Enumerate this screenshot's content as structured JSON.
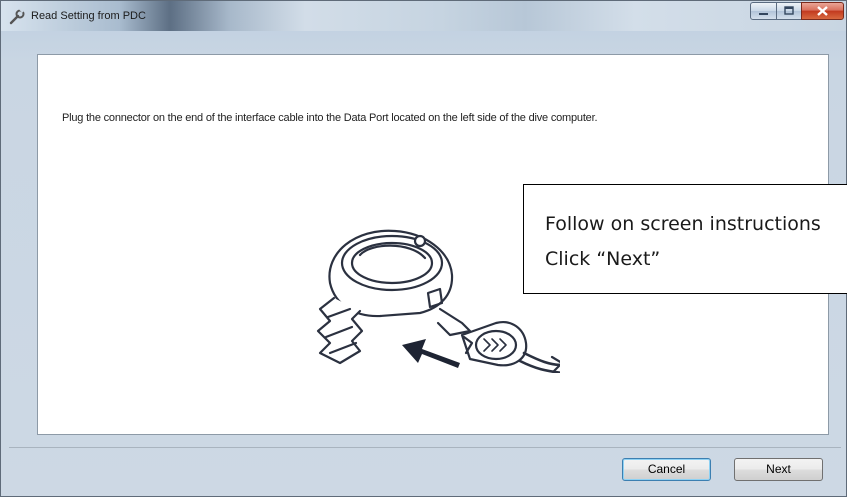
{
  "window": {
    "title": "Read Setting from PDC",
    "icon": "wrench-icon"
  },
  "content": {
    "instruction": "Plug the connector on the end of the interface cable  into the Data Port located on the left side of the dive computer.",
    "illustration": "dive-computer-cable-connection"
  },
  "callout": {
    "line1": "Follow on screen instructions",
    "line2": "Click “Next”"
  },
  "buttons": {
    "cancel": "Cancel",
    "next": "Next"
  }
}
